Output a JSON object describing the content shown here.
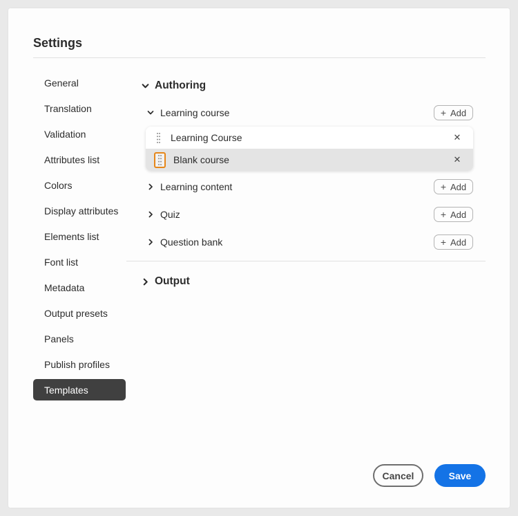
{
  "window": {
    "title": "Settings"
  },
  "sidebar": {
    "items": [
      {
        "label": "General",
        "selected": false
      },
      {
        "label": "Translation",
        "selected": false
      },
      {
        "label": "Validation",
        "selected": false
      },
      {
        "label": "Attributes list",
        "selected": false
      },
      {
        "label": "Colors",
        "selected": false
      },
      {
        "label": "Display attributes",
        "selected": false
      },
      {
        "label": "Elements list",
        "selected": false
      },
      {
        "label": "Font list",
        "selected": false
      },
      {
        "label": "Metadata",
        "selected": false
      },
      {
        "label": "Output presets",
        "selected": false
      },
      {
        "label": "Panels",
        "selected": false
      },
      {
        "label": "Publish profiles",
        "selected": false
      },
      {
        "label": "Templates",
        "selected": true
      }
    ]
  },
  "content": {
    "authoring": {
      "label": "Authoring",
      "expanded": true,
      "groups": [
        {
          "label": "Learning course",
          "expanded": true
        },
        {
          "label": "Learning content",
          "expanded": false
        },
        {
          "label": "Quiz",
          "expanded": false
        },
        {
          "label": "Question bank",
          "expanded": false
        }
      ],
      "templates": [
        {
          "label": "Learning Course",
          "highlighted": false
        },
        {
          "label": "Blank course",
          "highlighted": true
        }
      ]
    },
    "output": {
      "label": "Output",
      "expanded": false
    }
  },
  "controls": {
    "add_plus": "+",
    "add_label": "Add",
    "close_icon": "✕"
  },
  "footer": {
    "cancel_label": "Cancel",
    "save_label": "Save"
  },
  "colors": {
    "accent_blue": "#1473e6",
    "focus_orange": "#e68619",
    "selected_item_bg": "#404040",
    "row_highlight_bg": "#e4e4e4",
    "text_primary": "#2c2c2c"
  }
}
